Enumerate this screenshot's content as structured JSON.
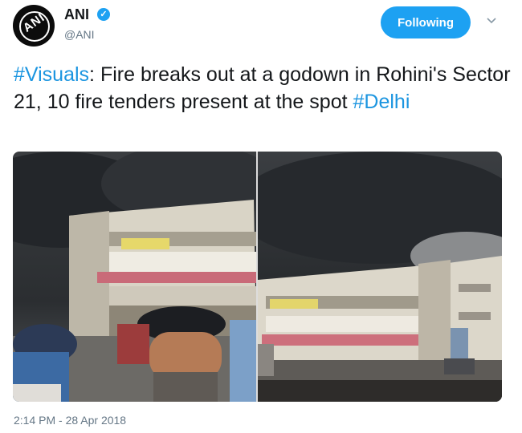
{
  "author": {
    "name": "ANI",
    "handle": "@ANI",
    "avatar_text": "ANI",
    "verified_icon": "verified-badge-icon"
  },
  "follow_button": {
    "label": "Following"
  },
  "menu_icon": "chevron-down-icon",
  "tweet": {
    "parts": [
      {
        "text": "#Visuals",
        "type": "hashtag"
      },
      {
        "text": ": Fire breaks out at a godown in Rohini's Sector 21, 10 fire tenders present at the spot ",
        "type": "text"
      },
      {
        "text": "#Delhi",
        "type": "hashtag"
      }
    ],
    "timestamp": "2:14 PM - 28 Apr 2018"
  },
  "media": {
    "photos": [
      {
        "name": "fire-photo-left"
      },
      {
        "name": "fire-photo-right"
      }
    ]
  },
  "colors": {
    "accent": "#1da1f2",
    "hashtag": "#1b95e0",
    "muted": "#657786",
    "text": "#14171a"
  }
}
